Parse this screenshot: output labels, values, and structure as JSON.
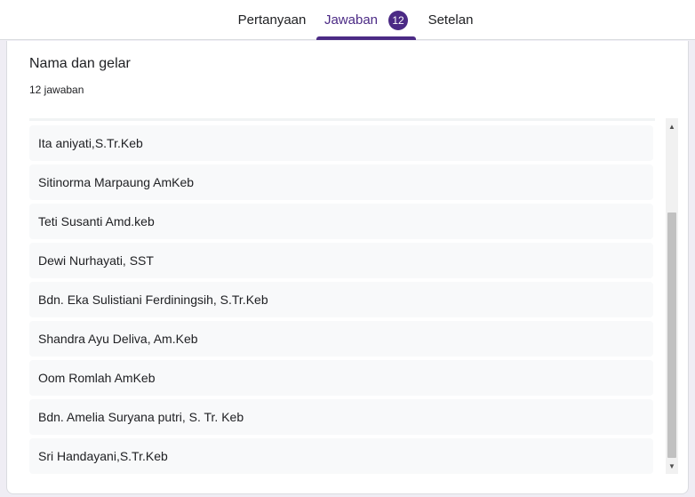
{
  "tabs": [
    {
      "label": "Pertanyaan"
    },
    {
      "label": "Jawaban",
      "badge": "12"
    },
    {
      "label": "Setelan"
    }
  ],
  "question": {
    "title": "Nama dan gelar",
    "count": "12 jawaban"
  },
  "responses": [
    "Ita aniyati,S.Tr.Keb",
    "Sitinorma Marpaung AmKeb",
    "Teti Susanti Amd.keb",
    "Dewi Nurhayati, SST",
    "Bdn. Eka Sulistiani Ferdiningsih, S.Tr.Keb",
    "Shandra Ayu Deliva, Am.Keb",
    "Oom Romlah AmKeb",
    "Bdn. Amelia Suryana putri, S. Tr. Keb",
    "Sri Handayani,S.Tr.Keb"
  ],
  "icons": {
    "scroll_up": "triangle-up",
    "scroll_down": "triangle-down"
  },
  "colors": {
    "accent": "#4b2a85",
    "background": "#efedf4",
    "item_background": "#f8f9fa"
  }
}
